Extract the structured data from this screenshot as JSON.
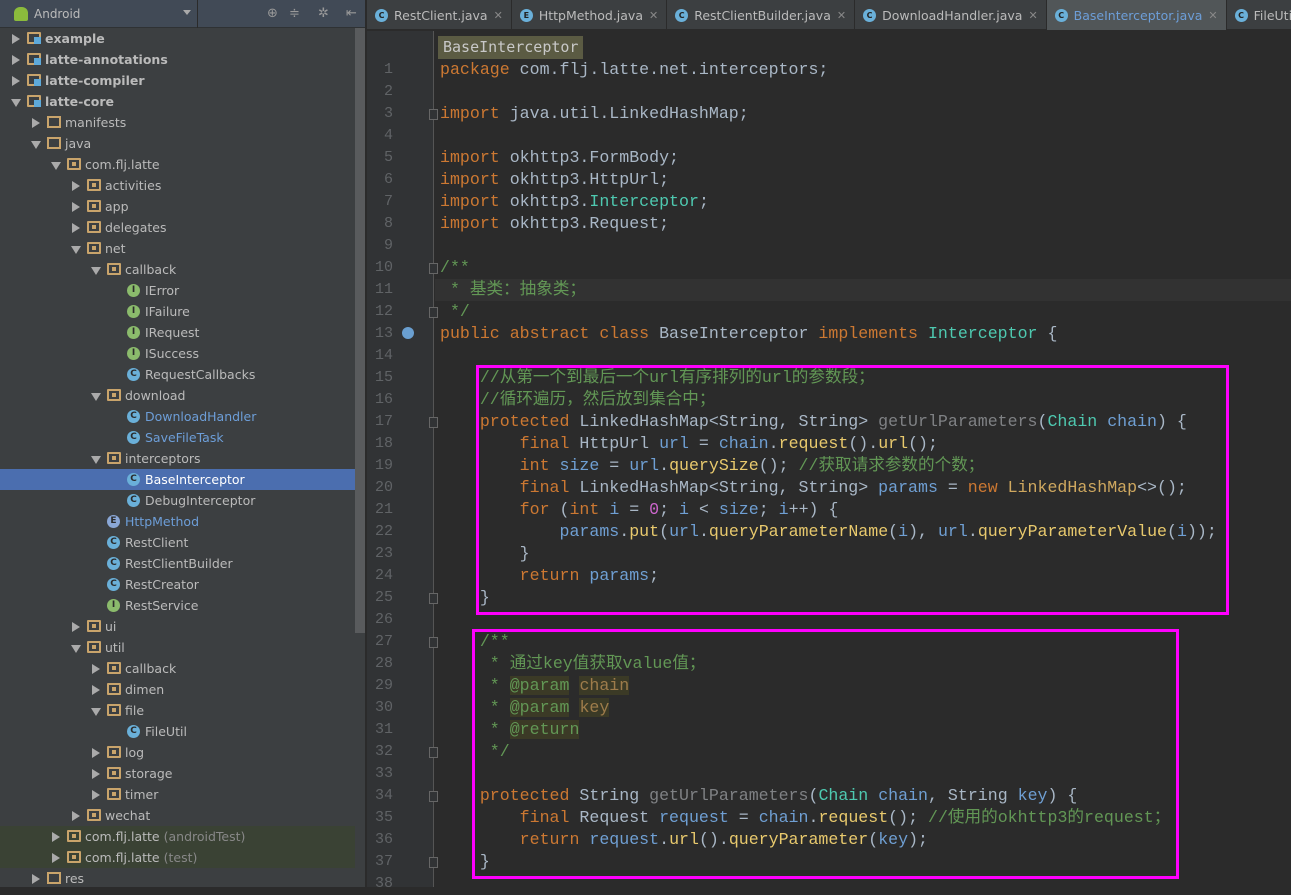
{
  "sidebar": {
    "view": "Android",
    "tools": [
      "locate-icon",
      "collapse-icon",
      "gear-icon",
      "hide-icon"
    ],
    "items": [
      {
        "label": "example",
        "depth": 0,
        "arrow": "c",
        "icon": "folder",
        "style": "bold"
      },
      {
        "label": "latte-annotations",
        "depth": 0,
        "arrow": "c",
        "icon": "folder",
        "style": "bold"
      },
      {
        "label": "latte-compiler",
        "depth": 0,
        "arrow": "c",
        "icon": "folder",
        "style": "bold"
      },
      {
        "label": "latte-core",
        "depth": 0,
        "arrow": "e",
        "icon": "folder",
        "style": "bold"
      },
      {
        "label": "manifests",
        "depth": 1,
        "arrow": "c",
        "icon": "plain"
      },
      {
        "label": "java",
        "depth": 1,
        "arrow": "e",
        "icon": "plain"
      },
      {
        "label": "com.flj.latte",
        "depth": 2,
        "arrow": "e",
        "icon": "pkg"
      },
      {
        "label": "activities",
        "depth": 3,
        "arrow": "c",
        "icon": "pkg"
      },
      {
        "label": "app",
        "depth": 3,
        "arrow": "c",
        "icon": "pkg"
      },
      {
        "label": "delegates",
        "depth": 3,
        "arrow": "c",
        "icon": "pkg"
      },
      {
        "label": "net",
        "depth": 3,
        "arrow": "e",
        "icon": "pkg"
      },
      {
        "label": "callback",
        "depth": 4,
        "arrow": "e",
        "icon": "pkg"
      },
      {
        "label": "IError",
        "depth": 5,
        "icon": "itf"
      },
      {
        "label": "IFailure",
        "depth": 5,
        "icon": "itf"
      },
      {
        "label": "IRequest",
        "depth": 5,
        "icon": "itf"
      },
      {
        "label": "ISuccess",
        "depth": 5,
        "icon": "itf"
      },
      {
        "label": "RequestCallbacks",
        "depth": 5,
        "icon": "cls"
      },
      {
        "label": "download",
        "depth": 4,
        "arrow": "e",
        "icon": "pkg"
      },
      {
        "label": "DownloadHandler",
        "depth": 5,
        "icon": "cls",
        "style": "blue"
      },
      {
        "label": "SaveFileTask",
        "depth": 5,
        "icon": "cls",
        "style": "blue"
      },
      {
        "label": "interceptors",
        "depth": 4,
        "arrow": "e",
        "icon": "pkg"
      },
      {
        "label": "BaseInterceptor",
        "depth": 5,
        "icon": "cls",
        "selected": true
      },
      {
        "label": "DebugInterceptor",
        "depth": 5,
        "icon": "cls"
      },
      {
        "label": "HttpMethod",
        "depth": 4,
        "icon": "enm",
        "style": "blue"
      },
      {
        "label": "RestClient",
        "depth": 4,
        "icon": "cls"
      },
      {
        "label": "RestClientBuilder",
        "depth": 4,
        "icon": "cls"
      },
      {
        "label": "RestCreator",
        "depth": 4,
        "icon": "cls"
      },
      {
        "label": "RestService",
        "depth": 4,
        "icon": "itf"
      },
      {
        "label": "ui",
        "depth": 3,
        "arrow": "c",
        "icon": "pkg"
      },
      {
        "label": "util",
        "depth": 3,
        "arrow": "e",
        "icon": "pkg"
      },
      {
        "label": "callback",
        "depth": 4,
        "arrow": "c",
        "icon": "pkg"
      },
      {
        "label": "dimen",
        "depth": 4,
        "arrow": "c",
        "icon": "pkg"
      },
      {
        "label": "file",
        "depth": 4,
        "arrow": "e",
        "icon": "pkg"
      },
      {
        "label": "FileUtil",
        "depth": 5,
        "icon": "cls"
      },
      {
        "label": "log",
        "depth": 4,
        "arrow": "c",
        "icon": "pkg"
      },
      {
        "label": "storage",
        "depth": 4,
        "arrow": "c",
        "icon": "pkg"
      },
      {
        "label": "timer",
        "depth": 4,
        "arrow": "c",
        "icon": "pkg"
      },
      {
        "label": "wechat",
        "depth": 3,
        "arrow": "c",
        "icon": "pkg"
      },
      {
        "label": "com.flj.latte",
        "suffix": "(androidTest)",
        "depth": 2,
        "arrow": "c",
        "icon": "pkg",
        "test": true
      },
      {
        "label": "com.flj.latte",
        "suffix": "(test)",
        "depth": 2,
        "arrow": "c",
        "icon": "pkg",
        "test": true
      },
      {
        "label": "res",
        "depth": 1,
        "arrow": "c",
        "icon": "plain"
      }
    ]
  },
  "tabs": [
    {
      "label": "RestClient.java",
      "icon": "C"
    },
    {
      "label": "HttpMethod.java",
      "icon": "E"
    },
    {
      "label": "RestClientBuilder.java",
      "icon": "C"
    },
    {
      "label": "DownloadHandler.java",
      "icon": "C"
    },
    {
      "label": "BaseInterceptor.java",
      "icon": "C",
      "active": true
    },
    {
      "label": "FileUtil.java",
      "icon": "C"
    }
  ],
  "editor": {
    "breadcrumb": "BaseInterceptor",
    "current_line": 11,
    "lines": [
      [
        [
          "package ",
          "k"
        ],
        [
          "com.flj.latte.net.interceptors;",
          "p"
        ]
      ],
      [],
      [
        [
          "import ",
          "k"
        ],
        [
          "java.util.LinkedHashMap;",
          "p"
        ]
      ],
      [],
      [
        [
          "import ",
          "k"
        ],
        [
          "okhttp3.FormBody;",
          "p"
        ]
      ],
      [
        [
          "import ",
          "k"
        ],
        [
          "okhttp3.HttpUrl;",
          "p"
        ]
      ],
      [
        [
          "import ",
          "k"
        ],
        [
          "okhttp3.",
          "p"
        ],
        [
          "Interceptor",
          "t"
        ],
        [
          ";",
          "p"
        ]
      ],
      [
        [
          "import ",
          "k"
        ],
        [
          "okhttp3.Request;",
          "p"
        ]
      ],
      [],
      [
        [
          "/**",
          "c"
        ]
      ],
      [
        [
          " * 基类：抽象类；",
          "c"
        ]
      ],
      [
        [
          " */",
          "c"
        ]
      ],
      [
        [
          "public ",
          "k"
        ],
        [
          "abstract ",
          "k"
        ],
        [
          "class ",
          "k"
        ],
        [
          "BaseInterceptor ",
          "p"
        ],
        [
          "implements ",
          "k"
        ],
        [
          "Interceptor",
          "t"
        ],
        [
          " {",
          "p"
        ]
      ],
      [],
      [
        [
          "    //从第一个到最后一个url有序排列的url的参数段；",
          "c"
        ]
      ],
      [
        [
          "    //循环遍历，然后放到集合中；",
          "c"
        ]
      ],
      [
        [
          "    protected ",
          "k"
        ],
        [
          "LinkedHashMap<String, String> ",
          "p"
        ],
        [
          "getUrlParameters",
          "g"
        ],
        [
          "(",
          "p"
        ],
        [
          "Chain ",
          "t"
        ],
        [
          "chain",
          "v"
        ],
        [
          ") {",
          "p"
        ]
      ],
      [
        [
          "        final ",
          "k"
        ],
        [
          "HttpUrl ",
          "p"
        ],
        [
          "url",
          "v"
        ],
        [
          " = ",
          "p"
        ],
        [
          "chain",
          "v"
        ],
        [
          ".",
          "p"
        ],
        [
          "request",
          "m"
        ],
        [
          "().",
          "p"
        ],
        [
          "url",
          "m"
        ],
        [
          "();",
          "p"
        ]
      ],
      [
        [
          "        int ",
          "k"
        ],
        [
          "size",
          "v"
        ],
        [
          " = ",
          "p"
        ],
        [
          "url",
          "v"
        ],
        [
          ".",
          "p"
        ],
        [
          "querySize",
          "m"
        ],
        [
          "(); ",
          "p"
        ],
        [
          "//获取请求参数的个数；",
          "c"
        ]
      ],
      [
        [
          "        final ",
          "k"
        ],
        [
          "LinkedHashMap<String, String> ",
          "p"
        ],
        [
          "params",
          "v"
        ],
        [
          " = ",
          "p"
        ],
        [
          "new ",
          "k"
        ],
        [
          "LinkedHashMap",
          "it"
        ],
        [
          "<>();",
          "p"
        ]
      ],
      [
        [
          "        for ",
          "k"
        ],
        [
          "(",
          "p"
        ],
        [
          "int ",
          "k"
        ],
        [
          "i",
          "v"
        ],
        [
          " = ",
          "p"
        ],
        [
          "0",
          "n"
        ],
        [
          "; ",
          "p"
        ],
        [
          "i",
          "v"
        ],
        [
          " < ",
          "p"
        ],
        [
          "size",
          "v"
        ],
        [
          "; ",
          "p"
        ],
        [
          "i",
          "v"
        ],
        [
          "++) {",
          "p"
        ]
      ],
      [
        [
          "            params",
          "v"
        ],
        [
          ".",
          "p"
        ],
        [
          "put",
          "m"
        ],
        [
          "(",
          "p"
        ],
        [
          "url",
          "v"
        ],
        [
          ".",
          "p"
        ],
        [
          "queryParameterName",
          "m"
        ],
        [
          "(",
          "p"
        ],
        [
          "i",
          "v"
        ],
        [
          "), ",
          "p"
        ],
        [
          "url",
          "v"
        ],
        [
          ".",
          "p"
        ],
        [
          "queryParameterValue",
          "m"
        ],
        [
          "(",
          "p"
        ],
        [
          "i",
          "v"
        ],
        [
          "));",
          "p"
        ]
      ],
      [
        [
          "        }",
          "p"
        ]
      ],
      [
        [
          "        return ",
          "k"
        ],
        [
          "params",
          "v"
        ],
        [
          ";",
          "p"
        ]
      ],
      [
        [
          "    }",
          "p"
        ]
      ],
      [],
      [
        [
          "    /**",
          "c"
        ]
      ],
      [
        [
          "     * 通过key值获取value值；",
          "c"
        ]
      ],
      [
        [
          "     * ",
          "c"
        ],
        [
          "@param",
          "tg"
        ],
        [
          " ",
          "c"
        ],
        [
          "chain",
          "pr"
        ]
      ],
      [
        [
          "     * ",
          "c"
        ],
        [
          "@param",
          "tg"
        ],
        [
          " ",
          "c"
        ],
        [
          "key",
          "pr"
        ]
      ],
      [
        [
          "     * ",
          "c"
        ],
        [
          "@return",
          "tg"
        ]
      ],
      [
        [
          "     */",
          "c"
        ]
      ],
      [],
      [
        [
          "    protected ",
          "k"
        ],
        [
          "String ",
          "p"
        ],
        [
          "getUrlParameters",
          "g"
        ],
        [
          "(",
          "p"
        ],
        [
          "Chain ",
          "t"
        ],
        [
          "chain",
          "v"
        ],
        [
          ", ",
          "p"
        ],
        [
          "String ",
          "p"
        ],
        [
          "key",
          "v"
        ],
        [
          ") {",
          "p"
        ]
      ],
      [
        [
          "        final ",
          "k"
        ],
        [
          "Request ",
          "p"
        ],
        [
          "request",
          "v"
        ],
        [
          " = ",
          "p"
        ],
        [
          "chain",
          "v"
        ],
        [
          ".",
          "p"
        ],
        [
          "request",
          "m"
        ],
        [
          "(); ",
          "p"
        ],
        [
          "//使用的okhttp3的request；",
          "c"
        ]
      ],
      [
        [
          "        return ",
          "k"
        ],
        [
          "request",
          "v"
        ],
        [
          ".",
          "p"
        ],
        [
          "url",
          "m"
        ],
        [
          "().",
          "p"
        ],
        [
          "queryParameter",
          "m"
        ],
        [
          "(",
          "p"
        ],
        [
          "key",
          "v"
        ],
        [
          ");",
          "p"
        ]
      ],
      [
        [
          "    }",
          "p"
        ]
      ],
      []
    ]
  },
  "colors": {
    "highlight_box": "#ff00ff",
    "selection": "#4b6eaf"
  }
}
